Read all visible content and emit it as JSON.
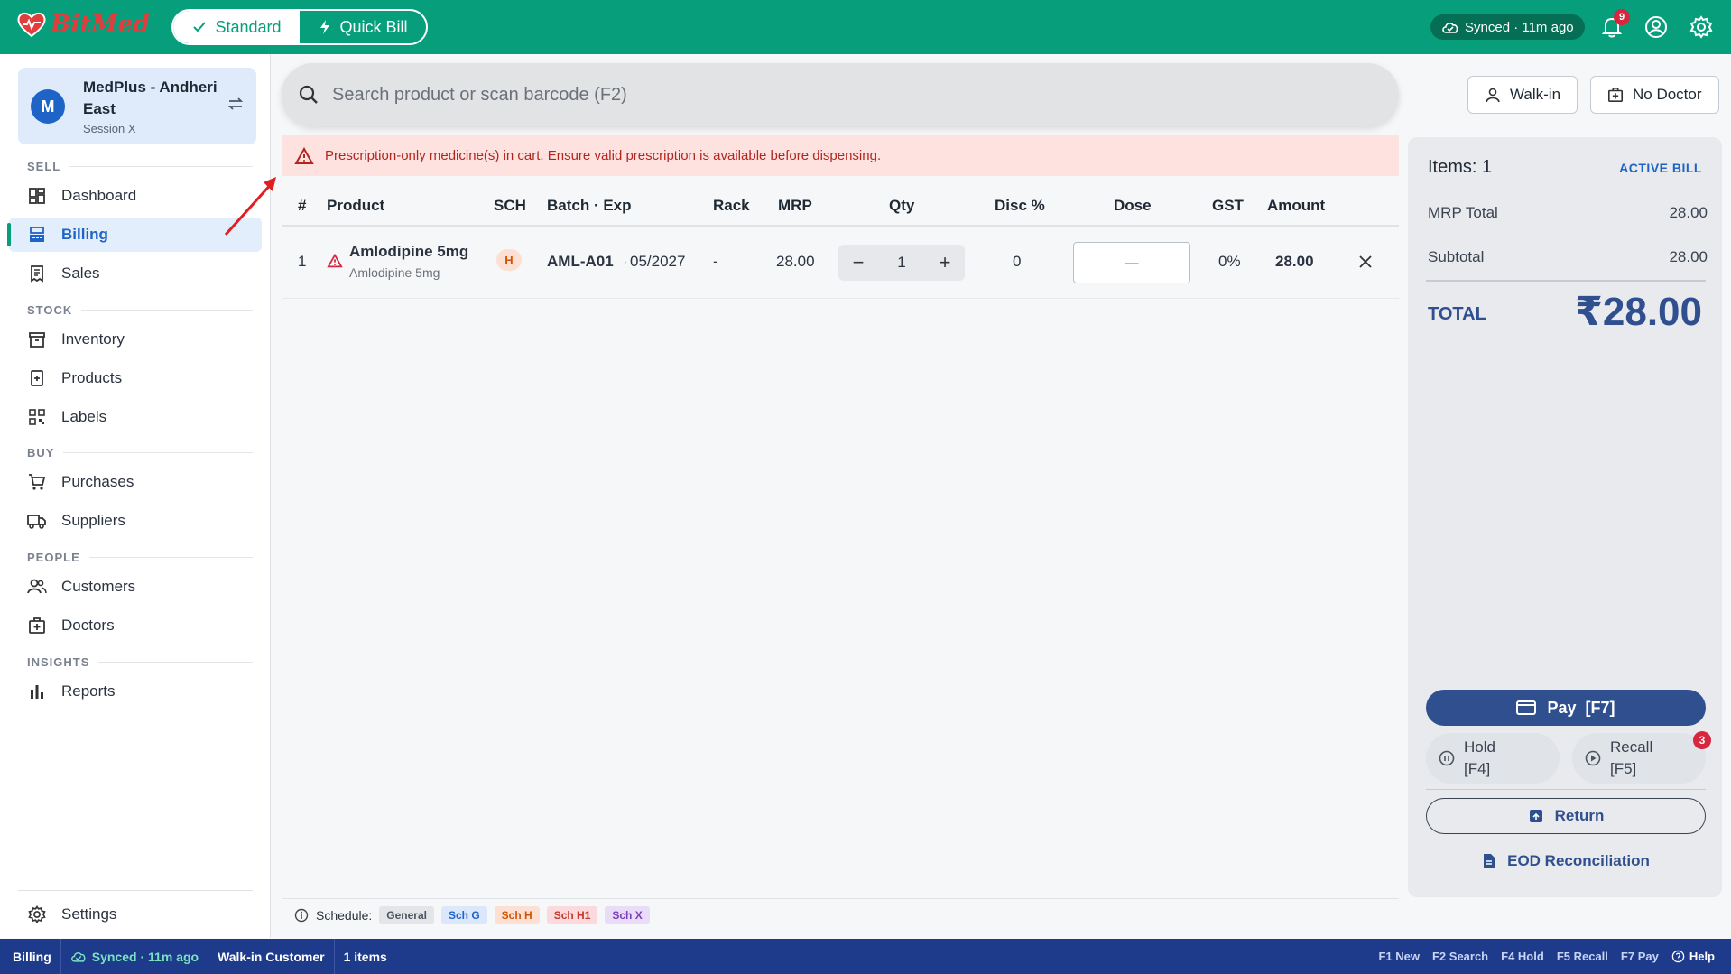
{
  "app": {
    "logo_text": "BitMed",
    "mode": {
      "standard": "Standard",
      "quick": "Quick Bill"
    },
    "sync": "Synced · 11m ago",
    "notification_count": "9"
  },
  "store": {
    "initial": "M",
    "name": "MedPlus - Andheri East",
    "session": "Session X"
  },
  "sidebar": {
    "sections": {
      "sell": "SELL",
      "stock": "STOCK",
      "buy": "BUY",
      "people": "PEOPLE",
      "insights": "INSIGHTS"
    },
    "items": [
      {
        "label": "Dashboard",
        "icon": "dashboard-icon"
      },
      {
        "label": "Billing",
        "icon": "billing-icon"
      },
      {
        "label": "Sales",
        "icon": "receipt-icon"
      },
      {
        "label": "Inventory",
        "icon": "inventory-icon"
      },
      {
        "label": "Products",
        "icon": "medical-box-icon"
      },
      {
        "label": "Labels",
        "icon": "qr-code-icon"
      },
      {
        "label": "Purchases",
        "icon": "cart-icon"
      },
      {
        "label": "Suppliers",
        "icon": "truck-icon"
      },
      {
        "label": "Customers",
        "icon": "people-icon"
      },
      {
        "label": "Doctors",
        "icon": "medical-bag-icon"
      },
      {
        "label": "Reports",
        "icon": "bar-chart-icon"
      }
    ],
    "settings": "Settings"
  },
  "search": {
    "placeholder": "Search product or scan barcode (F2)"
  },
  "header": {
    "walkin": "Walk-in",
    "doctor": "No Doctor"
  },
  "warning": "Prescription-only medicine(s) in cart. Ensure valid prescription is available before dispensing.",
  "table": {
    "columns": [
      "#",
      "Product",
      "SCH",
      "Batch · Exp",
      "Rack",
      "MRP",
      "Qty",
      "Disc %",
      "Dose",
      "GST",
      "Amount"
    ],
    "rows": [
      {
        "index": "1",
        "name": "Amlodipine 5mg",
        "generic": "Amlodipine 5mg",
        "sch": "H",
        "batch": "AML-A01",
        "exp": "05/2027",
        "rack": "-",
        "mrp": "28.00",
        "qty": "1",
        "disc": "0",
        "dose_placeholder": "—",
        "gst": "0%",
        "amount": "28.00"
      }
    ]
  },
  "legend": {
    "label": "Schedule:",
    "chips": [
      "General",
      "Sch G",
      "Sch H",
      "Sch H1",
      "Sch X"
    ]
  },
  "bill": {
    "items": "Items: 1",
    "status": "ACTIVE BILL",
    "mrp_total_label": "MRP Total",
    "mrp_total": "28.00",
    "subtotal_label": "Subtotal",
    "subtotal": "28.00",
    "total_label": "TOTAL",
    "total": "₹28.00",
    "pay": "Pay  [F7]",
    "hold": "Hold [F4]",
    "recall": "Recall [F5]",
    "recall_count": "3",
    "return": "Return",
    "eod": "EOD Reconciliation"
  },
  "statusbar": {
    "page": "Billing",
    "sync": "Synced · 11m ago",
    "customer": "Walk-in Customer",
    "items": "1 items",
    "shortcuts": [
      "F1 New",
      "F2 Search",
      "F4 Hold",
      "F5 Recall",
      "F7 Pay"
    ],
    "help": "Help"
  },
  "colors": {
    "brand": "#079f7b",
    "primary": "#2f4f8f",
    "status_bar": "#1e3a8a",
    "warning_bg": "#fde2e0",
    "danger": "#d7263d"
  }
}
